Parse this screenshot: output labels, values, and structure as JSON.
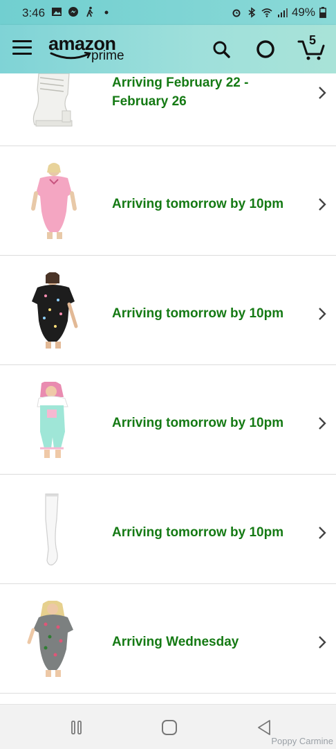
{
  "status_bar": {
    "time": "3:46",
    "battery": "49%",
    "left_icons": [
      "gallery-icon",
      "messenger-icon",
      "walking-icon",
      "dot-icon"
    ],
    "right_icons": [
      "alarm-icon",
      "bluetooth-icon",
      "wifi-icon",
      "signal-icon",
      "battery-icon"
    ]
  },
  "header": {
    "logo_word": "amazon",
    "logo_sub": "prime",
    "cart_count": "5",
    "icons": [
      "menu-icon",
      "search-icon",
      "alexa-icon",
      "cart-icon"
    ]
  },
  "orders": [
    {
      "status": "Arriving February 22 - February 26",
      "item": "white-boot"
    },
    {
      "status": "Arriving tomorrow by 10pm",
      "item": "pink-bodysuit"
    },
    {
      "status": "Arriving tomorrow by 10pm",
      "item": "black-print-bodysuit"
    },
    {
      "status": "Arriving tomorrow by 10pm",
      "item": "mint-overalls"
    },
    {
      "status": "Arriving tomorrow by 10pm",
      "item": "white-stocking"
    },
    {
      "status": "Arriving Wednesday",
      "item": "gray-print-bodysuit"
    }
  ],
  "nav": [
    "recents-icon",
    "home-icon",
    "back-icon"
  ],
  "watermark": "Poppy Carmine",
  "colors": {
    "accent_green": "#157a14",
    "header_teal": "#8ad9d7"
  }
}
